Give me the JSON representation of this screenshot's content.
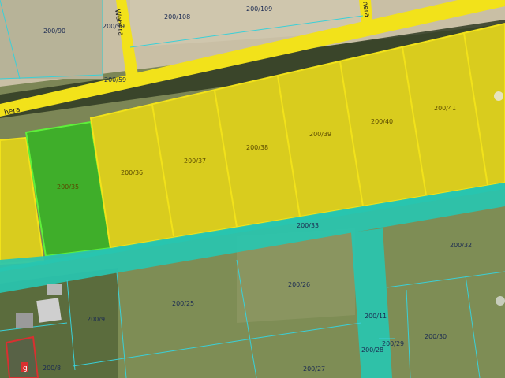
{
  "map": {
    "parcel_labels": {
      "p200_90": "200/90",
      "p200_99": "200/99",
      "p200_108": "200/108",
      "p200_109": "200/109",
      "p200_59": "200/59",
      "p200_35": "200/35",
      "p200_36": "200/36",
      "p200_37": "200/37",
      "p200_38": "200/38",
      "p200_39": "200/39",
      "p200_40": "200/40",
      "p200_41": "200/41",
      "p200_33": "200/33",
      "p200_32": "200/32",
      "p200_26": "200/26",
      "p200_25": "200/25",
      "p200_9": "200/9",
      "p200_11": "200/11",
      "p200_29": "200/29",
      "p200_28": "200/28",
      "p200_30": "200/30",
      "p200_27": "200/27",
      "p200_8": "200/8"
    },
    "street_labels": {
      "street_a": "Wehera",
      "street_b": "hera",
      "street_c": "hera"
    },
    "marker_label": "g",
    "colors": {
      "road_yellow": "#f2e21a",
      "parcel_yellow": "#d9cc1e",
      "parcel_green": "#3fae2a",
      "strip_cyan": "#28c6b0",
      "boundary_cyan": "#3ad0d8",
      "building_red": "#d83030"
    }
  }
}
